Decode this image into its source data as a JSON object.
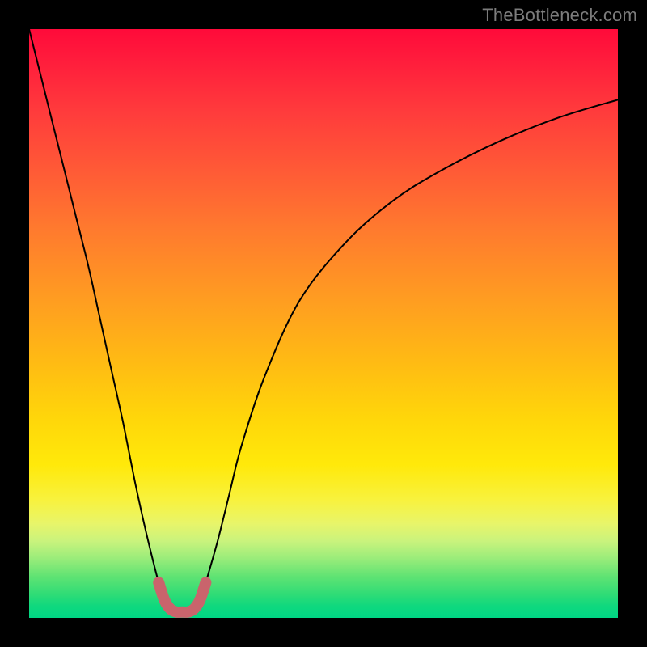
{
  "watermark": "TheBottleneck.com",
  "colors": {
    "frame": "#000000",
    "curve": "#000000",
    "valley_marker": "#c9646c"
  },
  "chart_data": {
    "type": "line",
    "title": "",
    "xlabel": "",
    "ylabel": "",
    "xlim": [
      0,
      100
    ],
    "ylim": [
      0,
      100
    ],
    "series": [
      {
        "name": "bottleneck-curve",
        "x": [
          0,
          2,
          4,
          6,
          8,
          10,
          12,
          14,
          16,
          18,
          20,
          22,
          23,
          24,
          25,
          26,
          27,
          28,
          29,
          30,
          32,
          34,
          36,
          40,
          46,
          54,
          62,
          70,
          80,
          90,
          100
        ],
        "y": [
          100,
          92,
          84,
          76,
          68,
          60,
          51,
          42,
          33,
          23,
          14,
          6,
          3,
          1.5,
          1,
          1,
          1,
          1.5,
          3,
          6,
          13,
          21,
          29,
          41,
          54,
          64,
          71,
          76,
          81,
          85,
          88
        ]
      }
    ],
    "annotations": [
      {
        "name": "valley-marker",
        "x_range": [
          22,
          30
        ],
        "y_range": [
          0,
          12
        ]
      }
    ]
  }
}
